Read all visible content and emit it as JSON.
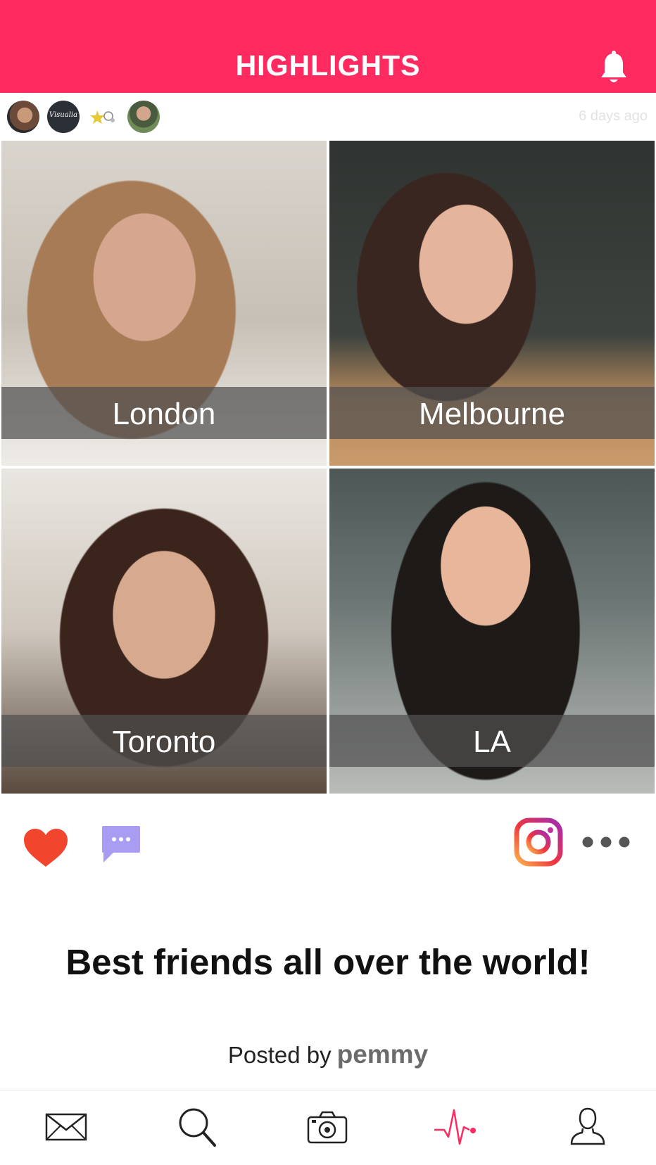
{
  "header": {
    "title": "HIGHLIGHTS",
    "accent_color": "#ff2a5f",
    "notification_icon": "bell-icon"
  },
  "post": {
    "avatars": [
      {
        "name": "avatar-1"
      },
      {
        "name": "avatar-2",
        "text": "Visualia"
      },
      {
        "name": "avatar-3"
      },
      {
        "name": "avatar-4"
      }
    ],
    "timestamp": "6 days ago",
    "tiles": [
      {
        "label": "London"
      },
      {
        "label": "Melbourne"
      },
      {
        "label": "Toronto"
      },
      {
        "label": "LA"
      }
    ],
    "actions": {
      "like_icon": "heart-icon",
      "like_color": "#f2452e",
      "comment_icon": "comment-icon",
      "comment_color": "#a89cf3",
      "share_icon": "instagram-icon",
      "more_icon": "more-icon"
    },
    "caption": "Best friends all over the world!",
    "posted_by_prefix": "Posted by",
    "posted_by_user": "pemmy"
  },
  "tabbar": {
    "items": [
      {
        "icon": "inbox-icon"
      },
      {
        "icon": "search-icon"
      },
      {
        "icon": "camera-icon"
      },
      {
        "icon": "activity-icon",
        "active": true,
        "active_color": "#ff2a5f"
      },
      {
        "icon": "profile-icon"
      }
    ]
  }
}
